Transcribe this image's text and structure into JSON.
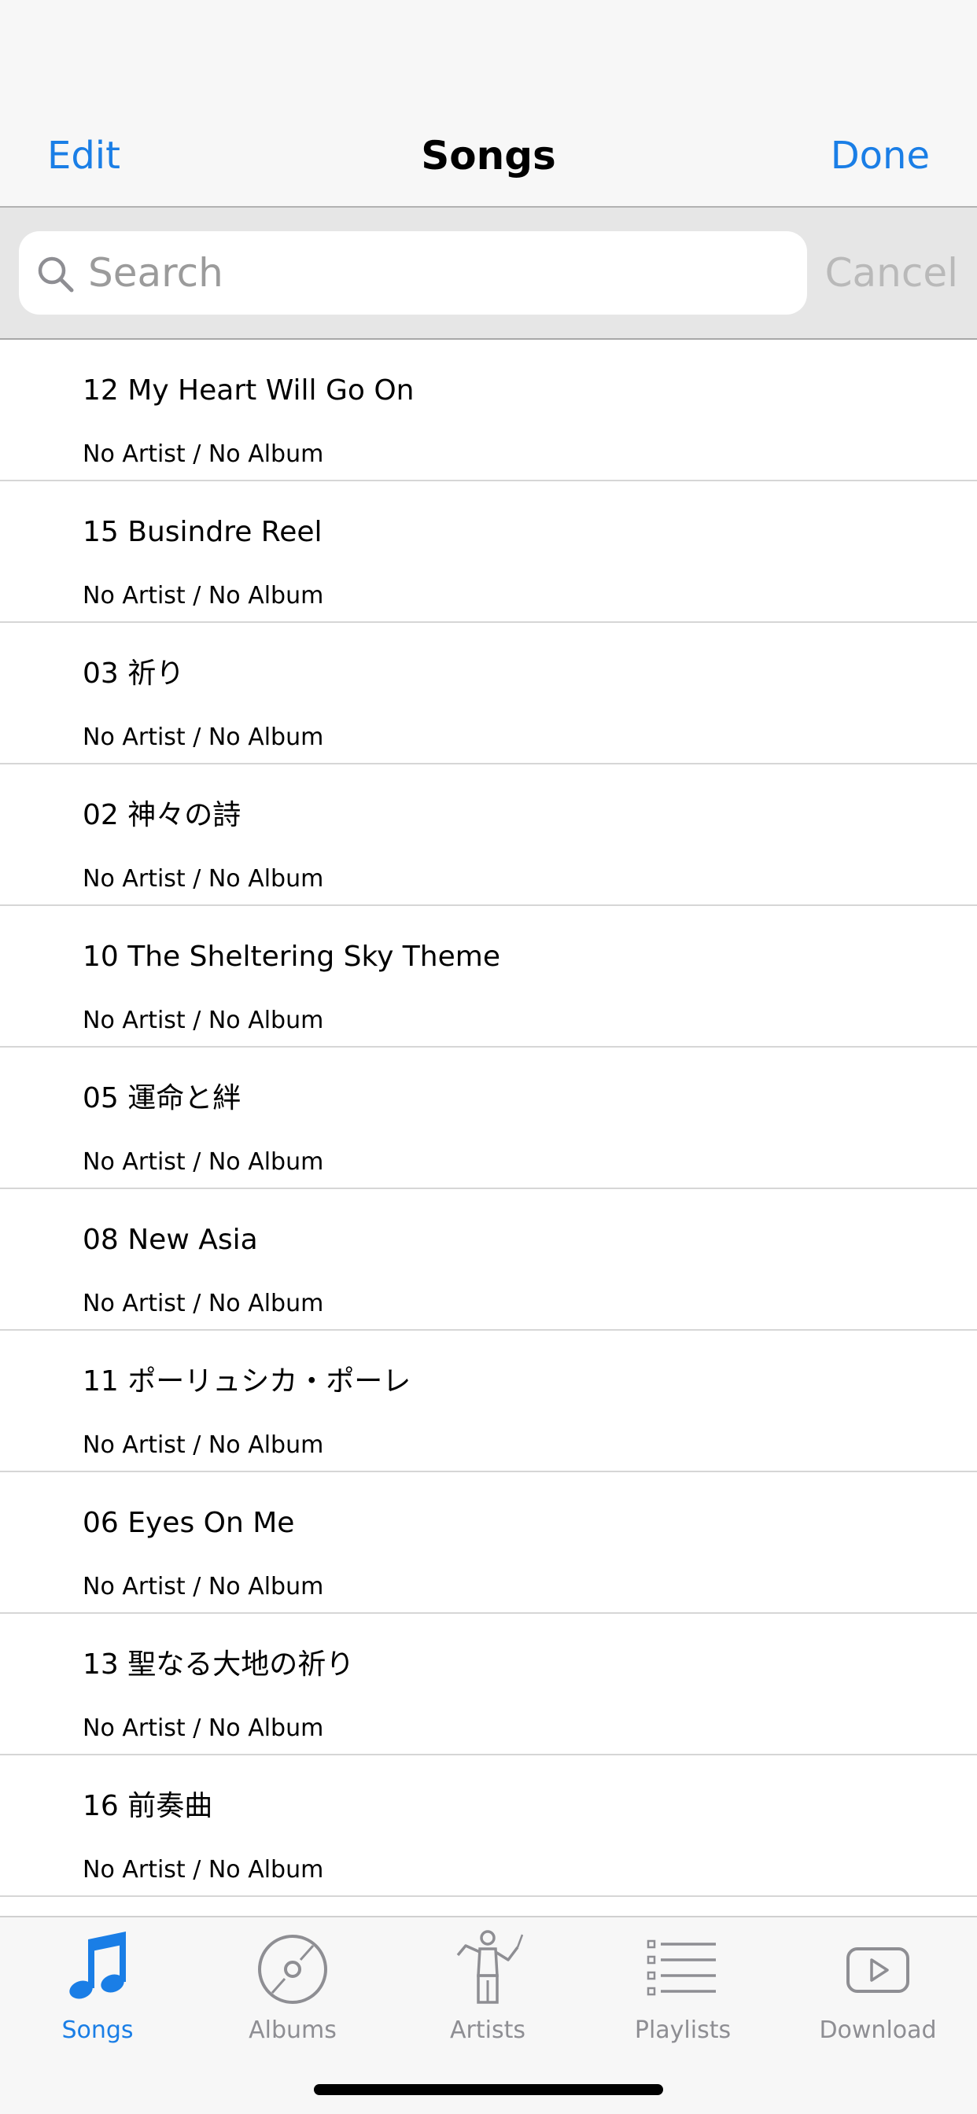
{
  "nav": {
    "title": "Songs",
    "left_button": "Edit",
    "right_button": "Done"
  },
  "search": {
    "placeholder": "Search",
    "value": "",
    "cancel_label": "Cancel",
    "icon": "magnifying-glass"
  },
  "songs": [
    {
      "title": "12 My Heart Will Go On",
      "subtitle": "No Artist / No Album"
    },
    {
      "title": "15 Busindre Reel",
      "subtitle": "No Artist / No Album"
    },
    {
      "title": "03 祈り",
      "subtitle": "No Artist / No Album"
    },
    {
      "title": "02 神々の詩",
      "subtitle": "No Artist / No Album"
    },
    {
      "title": "10 The Sheltering Sky Theme",
      "subtitle": "No Artist / No Album"
    },
    {
      "title": "05 運命と絆",
      "subtitle": "No Artist / No Album"
    },
    {
      "title": "08 New Asia",
      "subtitle": "No Artist / No Album"
    },
    {
      "title": "11 ポーリュシカ・ポーレ",
      "subtitle": "No Artist / No Album"
    },
    {
      "title": "06 Eyes On Me",
      "subtitle": "No Artist / No Album"
    },
    {
      "title": "13 聖なる大地の祈り",
      "subtitle": "No Artist / No Album"
    },
    {
      "title": "16 前奏曲",
      "subtitle": "No Artist / No Album"
    }
  ],
  "tabs": [
    {
      "label": "Songs",
      "icon": "music-note-icon",
      "active": true
    },
    {
      "label": "Albums",
      "icon": "disc-icon",
      "active": false
    },
    {
      "label": "Artists",
      "icon": "conductor-icon",
      "active": false
    },
    {
      "label": "Playlists",
      "icon": "list-icon",
      "active": false
    },
    {
      "label": "Download",
      "icon": "play-button-icon",
      "active": false
    }
  ],
  "colors": {
    "accent": "#1a7ee6",
    "inactive": "#8e8e93",
    "nav_background": "#f7f7f7",
    "search_background": "#e6e6e6"
  }
}
